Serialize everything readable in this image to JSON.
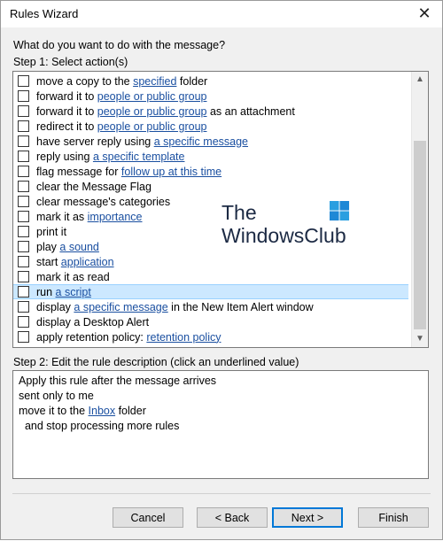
{
  "window": {
    "title": "Rules Wizard"
  },
  "question": "What do you want to do with the message?",
  "step1_label": "Step 1: Select action(s)",
  "actions": [
    {
      "pre": "move a copy to the ",
      "link": "specified",
      "post": " folder",
      "checked": false,
      "selected": false
    },
    {
      "pre": "forward it to ",
      "link": "people or public group",
      "post": "",
      "checked": false,
      "selected": false
    },
    {
      "pre": "forward it to ",
      "link": "people or public group",
      "post": " as an attachment",
      "checked": false,
      "selected": false
    },
    {
      "pre": "redirect it to ",
      "link": "people or public group",
      "post": "",
      "checked": false,
      "selected": false
    },
    {
      "pre": "have server reply using ",
      "link": "a specific message",
      "post": "",
      "checked": false,
      "selected": false
    },
    {
      "pre": "reply using ",
      "link": "a specific template",
      "post": "",
      "checked": false,
      "selected": false
    },
    {
      "pre": "flag message for ",
      "link": "follow up at this time",
      "post": "",
      "checked": false,
      "selected": false
    },
    {
      "pre": "clear the Message Flag",
      "link": "",
      "post": "",
      "checked": false,
      "selected": false
    },
    {
      "pre": "clear message's categories",
      "link": "",
      "post": "",
      "checked": false,
      "selected": false
    },
    {
      "pre": "mark it as ",
      "link": "importance",
      "post": "",
      "checked": false,
      "selected": false
    },
    {
      "pre": "print it",
      "link": "",
      "post": "",
      "checked": false,
      "selected": false
    },
    {
      "pre": "play ",
      "link": "a sound",
      "post": "",
      "checked": false,
      "selected": false
    },
    {
      "pre": "start ",
      "link": "application",
      "post": "",
      "checked": false,
      "selected": false
    },
    {
      "pre": "mark it as read",
      "link": "",
      "post": "",
      "checked": false,
      "selected": false
    },
    {
      "pre": "run ",
      "link": "a script",
      "post": "",
      "checked": false,
      "selected": true
    },
    {
      "pre": "display ",
      "link": "a specific message",
      "post": " in the New Item Alert window",
      "checked": false,
      "selected": false
    },
    {
      "pre": "display a Desktop Alert",
      "link": "",
      "post": "",
      "checked": false,
      "selected": false
    },
    {
      "pre": "apply retention policy: ",
      "link": "retention policy",
      "post": "",
      "checked": false,
      "selected": false
    }
  ],
  "step2_label": "Step 2: Edit the rule description (click an underlined value)",
  "description": {
    "line1": "Apply this rule after the message arrives",
    "line2": "sent only to me",
    "line3_pre": "move it to the ",
    "line3_link": "Inbox",
    "line3_post": " folder",
    "line4": "  and stop processing more rules"
  },
  "buttons": {
    "cancel": "Cancel",
    "back": "< Back",
    "next": "Next >",
    "finish": "Finish"
  },
  "watermark": {
    "line1": "The",
    "line2": "WindowsClub"
  },
  "colors": {
    "link": "#1a4fa0",
    "selection": "#cce8ff",
    "default_button_border": "#0078d7"
  }
}
